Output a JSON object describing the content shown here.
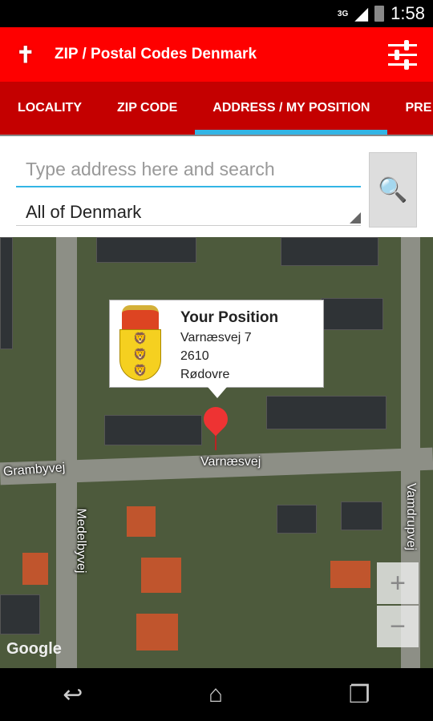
{
  "status_bar": {
    "network": "3G",
    "time": "1:58"
  },
  "app_bar": {
    "title": "ZIP / Postal Codes Denmark",
    "logo": "denmark-map-logo",
    "settings_icon": "sliders-icon"
  },
  "tabs": [
    {
      "label": "LOCALITY"
    },
    {
      "label": "ZIP CODE"
    },
    {
      "label": "ADDRESS / MY POSITION",
      "active": true
    },
    {
      "label": "PRE"
    }
  ],
  "search": {
    "placeholder": "Type address here and search",
    "value": "",
    "region": "All of Denmark",
    "button_icon": "magnifier-icon"
  },
  "map": {
    "popup": {
      "title": "Your Position",
      "street": "Varnæsvej 7",
      "zip": "2610",
      "city": "Rødovre"
    },
    "streets": [
      "Grambyvej",
      "Varnæsvej",
      "Medelbyvej",
      "Vamdrupvej"
    ],
    "zoom_in": "+",
    "zoom_out": "−",
    "attribution": "Google"
  },
  "colors": {
    "app_bar": "#fe0000",
    "tabs": "#c40000",
    "tab_indicator": "#33b5e5"
  }
}
